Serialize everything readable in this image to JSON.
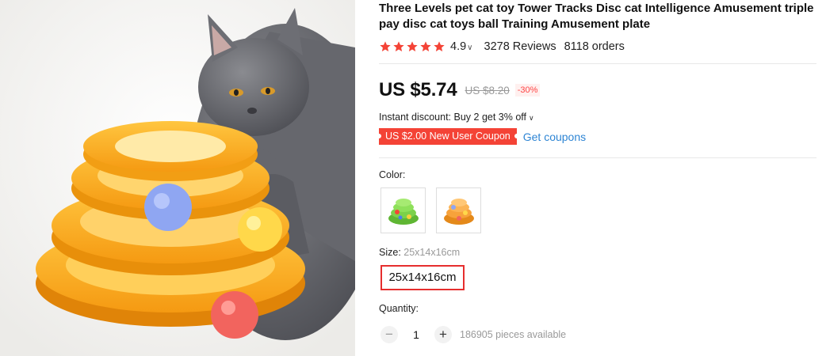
{
  "product": {
    "title": "Three Levels pet cat toy Tower Tracks Disc cat Intelligence Amusement triple pay disc cat toys ball Training Amusement plate"
  },
  "rating": {
    "value": "4.9",
    "stars": 5,
    "reviews_text": "3278 Reviews",
    "orders_text": "8118 orders",
    "star_color": "#f44336"
  },
  "price": {
    "current": "US $5.74",
    "original": "US $8.20",
    "discount": "-30%"
  },
  "promo": {
    "instant_discount": "Instant discount: Buy 2 get 3% off",
    "coupon_label": "US $2.00 New User Coupon",
    "get_coupons_label": "Get coupons"
  },
  "options": {
    "color_label": "Color:",
    "colors": [
      {
        "name": "green-tower-swatch",
        "accent": "#7bd14a"
      },
      {
        "name": "orange-tower-swatch",
        "accent": "#f7a23b"
      }
    ],
    "size_label": "Size:",
    "size_selected": "25x14x16cm",
    "size_option": "25x14x16cm"
  },
  "quantity": {
    "label": "Quantity:",
    "value": "1",
    "available": "186905 pieces available"
  },
  "colors": {
    "accent_red": "#f44336",
    "link_blue": "#2e85d4",
    "toy_yellow": "#fbb017"
  }
}
